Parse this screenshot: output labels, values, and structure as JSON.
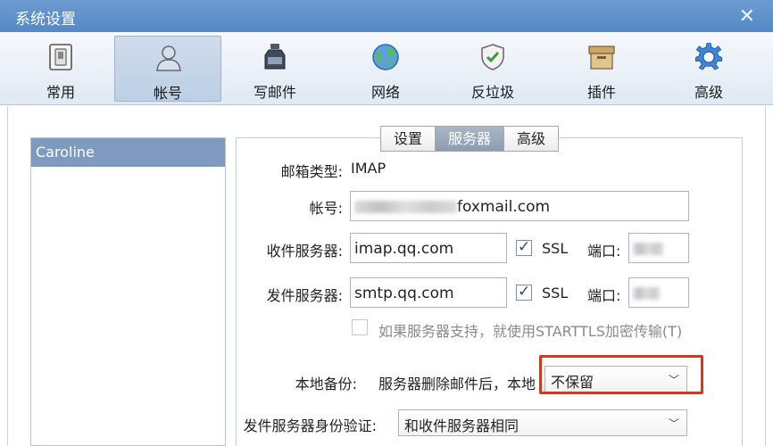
{
  "window": {
    "title": "系统设置",
    "close_glyph": "✕"
  },
  "toolbar": [
    {
      "name": "general",
      "label": "常用",
      "icon": "switch-icon"
    },
    {
      "name": "account",
      "label": "帐号",
      "icon": "user-icon",
      "active": true
    },
    {
      "name": "compose",
      "label": "写邮件",
      "icon": "ink-bottle-icon"
    },
    {
      "name": "network",
      "label": "网络",
      "icon": "globe-icon"
    },
    {
      "name": "antispam",
      "label": "反垃圾",
      "icon": "shield-check-icon"
    },
    {
      "name": "plugins",
      "label": "插件",
      "icon": "box-icon"
    },
    {
      "name": "advanced",
      "label": "高级",
      "icon": "gear-icon"
    }
  ],
  "accounts": {
    "selected": "Caroline"
  },
  "tabs": [
    {
      "label": "设置"
    },
    {
      "label": "服务器",
      "active": true
    },
    {
      "label": "高级"
    }
  ],
  "form": {
    "mailbox_type_label": "邮箱类型:",
    "mailbox_type_value": "IMAP",
    "account_label": "帐号:",
    "account_suffix": "foxmail.com",
    "incoming_label": "收件服务器:",
    "incoming_value": "imap.qq.com",
    "outgoing_label": "发件服务器:",
    "outgoing_value": "smtp.qq.com",
    "ssl_label": "SSL",
    "port_label": "端口:",
    "starttls_label": "如果服务器支持，就使用STARTTLS加密传输(T)",
    "backup_label": "本地备份:",
    "backup_desc": "服务器删除邮件后，本地",
    "backup_value": "不保留",
    "auth_label": "发件服务器身份验证:",
    "auth_value": "和收件服务器相同"
  },
  "colors": {
    "titlebar": "#5a8cc8",
    "selection": "#7e9bbf",
    "highlight": "#d9361e"
  }
}
